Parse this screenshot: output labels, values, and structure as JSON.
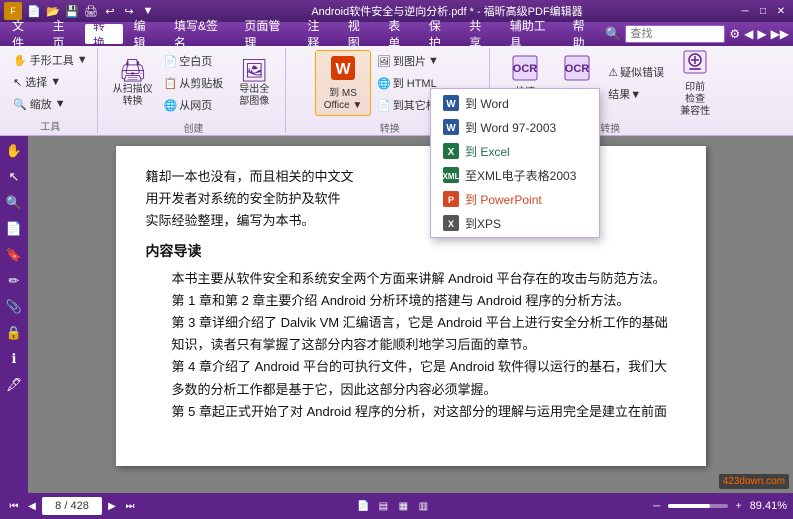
{
  "window": {
    "title": "Android软件安全与逆向分析.pdf * - 福昕高级PDF编辑器",
    "min_btn": "─",
    "max_btn": "□",
    "close_btn": "✕"
  },
  "menubar": {
    "items": [
      "文件",
      "主页",
      "转换",
      "编辑",
      "填写&签名",
      "页面管理",
      "注释",
      "视图",
      "表单",
      "保护",
      "共享",
      "辅助工具",
      "帮助"
    ],
    "active": "转换",
    "search_placeholder": "查找"
  },
  "ribbon": {
    "groups": [
      {
        "name": "工具",
        "buttons": [
          "手形工具",
          "选择",
          "缩放"
        ]
      },
      {
        "name": "创建",
        "buttons": [
          "从扫描仪",
          "空白页",
          "从剪贴板",
          "从网页",
          "导出全部图像"
        ]
      },
      {
        "name": "转换",
        "btn_ms_office": "到 MS\nOffice",
        "sub_buttons": [
          "到图片",
          "到 HTML",
          "到其它格式"
        ],
        "ocr_buttons": [
          "快速OCR",
          "OCR",
          "疑似错误结果",
          "印前检查兼容性"
        ]
      }
    ]
  },
  "dropdown": {
    "items": [
      {
        "label": "到 Word",
        "color": "#0078d4"
      },
      {
        "label": "到 Word 97-2003",
        "color": "#0078d4"
      },
      {
        "label": "到 Excel",
        "color": "#217346"
      },
      {
        "label": "至XML电子表格2003",
        "color": "#217346"
      },
      {
        "label": "到 PowerPoint",
        "color": "#d24726"
      },
      {
        "label": "到XPS",
        "color": "#555"
      }
    ]
  },
  "sidebar_tools": [
    "✋",
    "↖",
    "🔍",
    "📄",
    "🔖",
    "🖊",
    "📎",
    "🔒",
    "ℹ",
    "🖋"
  ],
  "document": {
    "body_text1": "籍却一本也没有，而且相关的中文文",
    "body_text2": "用开发者对系统的安全防护及软件",
    "body_text3": "实际经验整理，编写为本书。",
    "section_title": "内容导读",
    "para1": "本书主要从软件安全和系统安全两个方面来讲解 Android 平台存在的攻击与防范方法。",
    "para2": "第 1 章和第 2 章主要介绍 Android 分析环境的搭建与 Android 程序的分析方法。",
    "para3": "第 3 章详细介绍了 Dalvik VM 汇编语言，它是 Android 平台上进行安全分析工作的基础知识，读者只有掌握了这部分内容才能顺利地学习后面的章节。",
    "para4": "第 4 章介绍了 Android 平台的可执行文件，它是 Android 软件得以运行的基石，我们大多数的分析工作都是基于它，因此这部分内容必须掌握。",
    "para5": "第 5 章起正式开始了对 Android 程序的分析，对这部分的理解与运用完全是建立在前面"
  },
  "statusbar": {
    "page_current": "8",
    "page_total": "428",
    "nav_icons": [
      "⏮",
      "◀",
      "▶",
      "⏭"
    ],
    "view_icons": [
      "📄",
      "▤",
      "▦",
      "▥"
    ],
    "zoom": "89.41%",
    "zoom_out": "─",
    "zoom_in": "+"
  },
  "watermark": "423down.com"
}
